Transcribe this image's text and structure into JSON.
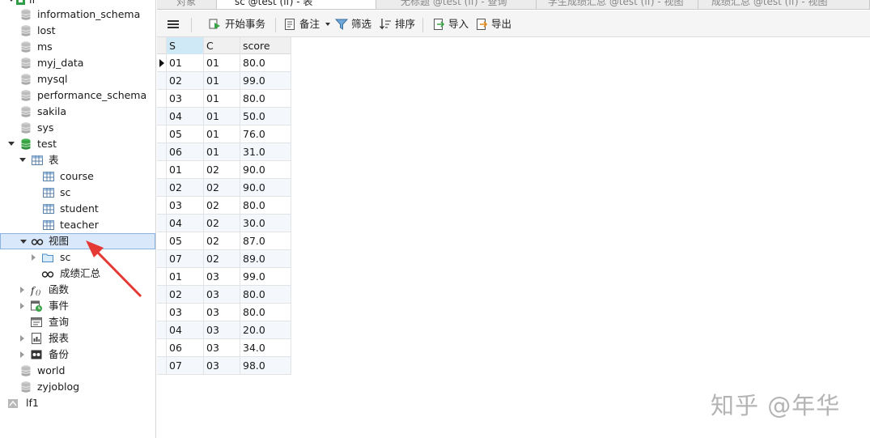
{
  "tabs": [
    {
      "label": "对象"
    },
    {
      "label": "sc @test (lf) - 表"
    },
    {
      "label": "无标题 @test (lf) - 查询"
    },
    {
      "label": "学生成绩汇总 @test (lf) - 视图"
    },
    {
      "label": "成绩汇总 @test (lf) - 视图"
    }
  ],
  "sidebar": {
    "connection_top": "lf",
    "databases": [
      {
        "label": "information_schema"
      },
      {
        "label": "lost"
      },
      {
        "label": "ms"
      },
      {
        "label": "myj_data"
      },
      {
        "label": "mysql"
      },
      {
        "label": "performance_schema"
      },
      {
        "label": "sakila"
      },
      {
        "label": "sys"
      }
    ],
    "open_db": "test",
    "tables_group": "表",
    "tables": [
      {
        "label": "course"
      },
      {
        "label": "sc"
      },
      {
        "label": "student"
      },
      {
        "label": "teacher"
      }
    ],
    "views_group": "视图",
    "views": [
      {
        "label": "sc"
      },
      {
        "label": "成绩汇总"
      }
    ],
    "functions_group": "函数",
    "events_group": "事件",
    "queries_group": "查询",
    "reports_group": "报表",
    "backups_group": "备份",
    "other_dbs": [
      {
        "label": "world"
      },
      {
        "label": "zyjoblog"
      }
    ],
    "connection_bottom": "lf1"
  },
  "toolbar": {
    "begin_transaction": "开始事务",
    "memo": "备注",
    "filter": "筛选",
    "sort": "排序",
    "import": "导入",
    "export": "导出"
  },
  "grid": {
    "columns": [
      "S",
      "C",
      "score"
    ],
    "rows": [
      [
        "01",
        "01",
        "80.0"
      ],
      [
        "02",
        "01",
        "99.0"
      ],
      [
        "03",
        "01",
        "80.0"
      ],
      [
        "04",
        "01",
        "50.0"
      ],
      [
        "05",
        "01",
        "76.0"
      ],
      [
        "06",
        "01",
        "31.0"
      ],
      [
        "01",
        "02",
        "90.0"
      ],
      [
        "02",
        "02",
        "90.0"
      ],
      [
        "03",
        "02",
        "80.0"
      ],
      [
        "04",
        "02",
        "30.0"
      ],
      [
        "05",
        "02",
        "87.0"
      ],
      [
        "07",
        "02",
        "89.0"
      ],
      [
        "01",
        "03",
        "99.0"
      ],
      [
        "02",
        "03",
        "80.0"
      ],
      [
        "03",
        "03",
        "80.0"
      ],
      [
        "04",
        "03",
        "20.0"
      ],
      [
        "06",
        "03",
        "34.0"
      ],
      [
        "07",
        "03",
        "98.0"
      ]
    ]
  },
  "watermark": "知乎 @年华",
  "colors": {
    "selection": "#d9e8fb",
    "header_selected": "#cfe9f7",
    "annotation_arrow": "#e53935",
    "db_open": "#3aa346"
  }
}
